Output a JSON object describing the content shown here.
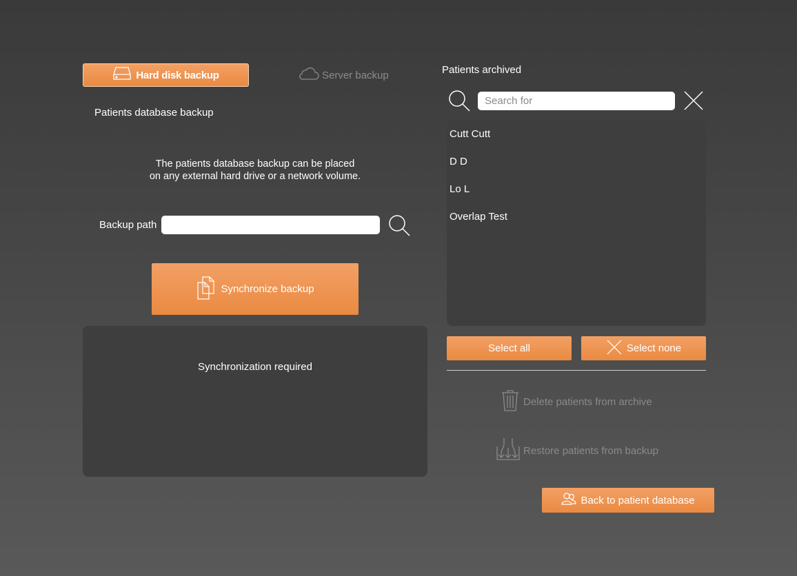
{
  "tabs": {
    "hard_disk": "Hard disk backup",
    "server": "Server backup"
  },
  "left": {
    "section_title": "Patients database backup",
    "description_line1": "The patients database backup can be placed",
    "description_line2": "on any external hard drive or a network volume.",
    "backup_path_label": "Backup path",
    "backup_path_value": "",
    "sync_button": "Synchronize backup",
    "status_text": "Synchronization required"
  },
  "right": {
    "title": "Patients archived",
    "search_placeholder": "Search for",
    "patients": [
      "Cutt Cutt",
      "D D",
      "Lo L",
      "Overlap Test"
    ],
    "select_all": "Select all",
    "select_none": "Select none",
    "delete_label": "Delete patients from archive",
    "restore_label": "Restore patients from backup",
    "back_button": "Back to patient database"
  },
  "colors": {
    "accent": "#ec8d46",
    "background": "#474747",
    "panel": "#3e3e3e",
    "disabled_text": "#8a8a8a"
  }
}
